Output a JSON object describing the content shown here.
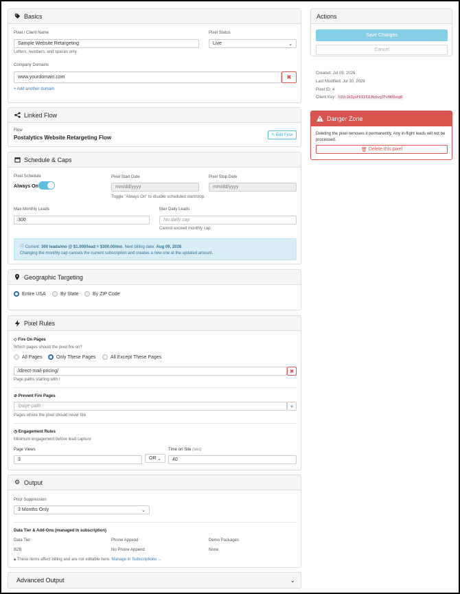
{
  "basics": {
    "title": "Basics",
    "name_label": "Pixel / Client Name",
    "name_value": "Sample Website Retargeting",
    "name_help": "Letters, numbers, and spaces only.",
    "status_label": "Pixel Status",
    "status_value": "Live",
    "domains_label": "Company Domains",
    "domain_value": "www.yourdomain.com",
    "add_domain": "+ Add another domain"
  },
  "linked_flow": {
    "title": "Linked Flow",
    "flow_label": "Flow",
    "flow_name": "Postalytics Website Retargeting Flow",
    "edit_label": "✎ Edit Flow"
  },
  "schedule": {
    "title": "Schedule & Caps",
    "schedule_label": "Pixel Schedule",
    "always_on": "Always On",
    "start_label": "Pixel Start Date",
    "start_placeholder": "mm/dd/yyyy",
    "stop_label": "Pixel Stop Date",
    "stop_placeholder": "mm/dd/yyyy",
    "toggle_help": "Toggle \"Always On\" to disable scheduled start/stop.",
    "monthly_label": "Max Monthly Leads",
    "monthly_value": "300",
    "daily_label": "Max Daily Leads",
    "daily_placeholder": "No daily cap",
    "daily_help": "Cannot exceed monthly cap.",
    "info_prefix": "Current: ",
    "info_bold": "300 leads/mo @ $1.000/lead = $300.00/mo",
    "info_mid": ". Next billing date: ",
    "info_date": "Aug 09, 2026",
    "info_end": ".",
    "info_line2": "Changing the monthly cap cancels the current subscription and creates a new one at the updated amount."
  },
  "geo": {
    "title": "Geographic Targeting",
    "options": [
      "Entire USA",
      "By State",
      "By ZIP Code"
    ]
  },
  "rules": {
    "title": "Pixel Rules",
    "fire_title": "Fire On Pages",
    "fire_q": "Which pages should the pixel fire on?",
    "fire_options": [
      "All Pages",
      "Only These Pages",
      "All Except These Pages"
    ],
    "page_value": "/direct-mail-pricing/",
    "page_help": "Page paths starting with /",
    "prevent_title": "Prevent Fire Pages",
    "prevent_placeholder": "/page-path",
    "prevent_help": "Pages where the pixel should never fire",
    "engage_title": "Engagement Rules",
    "engage_help": "Minimum engagement before lead capture",
    "views_label": "Page Views",
    "views_value": "3",
    "op_value": "OR",
    "time_label": "Time on Site",
    "time_unit": "(sec)",
    "time_value": "40"
  },
  "output": {
    "title": "Output",
    "prior_label": "Prior Suppression",
    "prior_value": "3 Months Only",
    "tier_title": "Data Tier & Add-Ons (managed in subscription)",
    "tier_label": "Data Tier",
    "tier_value": "B2B",
    "phone_label": "Phone Append",
    "phone_value": "No Phone Append",
    "demo_label": "Demo Packages",
    "demo_value": "None",
    "note": "These items affect billing and are not editable here.",
    "manage_link": "Manage in Subscriptions →"
  },
  "advanced": {
    "title": "Advanced Output"
  },
  "actions": {
    "title": "Actions",
    "save": "Save Changes",
    "cancel": "Cancel",
    "created": "Created: Jul 09, 2026",
    "modified": "Last Modified: Jul 30, 2026",
    "pixel_id": "Pixel ID: 4",
    "client_key_label": "Client Key:",
    "client_key": "UJUr2kIyoFOI1T2LMzbvg7Fz0K6bsg8"
  },
  "danger": {
    "title": "Danger Zone",
    "text": "Deleting the pixel removes it permanently. Any in-flight leads will not be processed.",
    "delete": "Delete this pixel"
  },
  "colors": {
    "primary": "#5bc0de",
    "danger_header": "#d9534f",
    "link": "#337ab7",
    "toggle": "#5bc0de",
    "info_bg": "#d9edf7"
  }
}
